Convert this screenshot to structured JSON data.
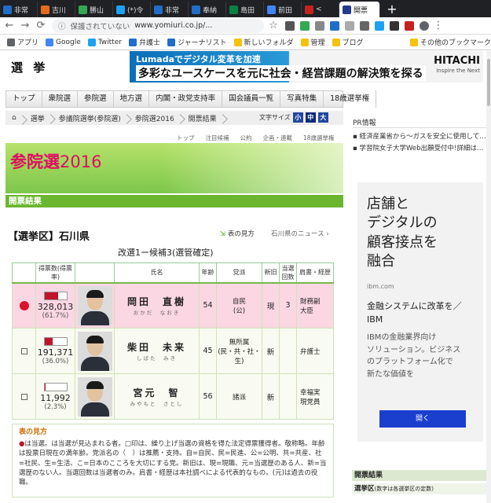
{
  "browser": {
    "tabs": [
      {
        "label": "非常",
        "color": "#1f6ec9",
        "glyph": "文"
      },
      {
        "label": "吉川",
        "color": "#e66a1e",
        "glyph": "吉"
      },
      {
        "label": "勝山",
        "color": "#34a853",
        "glyph": "map"
      },
      {
        "label": "(*)令",
        "color": "#1da1f2",
        "glyph": "bird"
      },
      {
        "label": "非常",
        "color": "#1f6ec9",
        "glyph": "文"
      },
      {
        "label": "奉納",
        "color": "#1f6ec9",
        "glyph": "文"
      },
      {
        "label": "島田",
        "color": "#0b8043",
        "glyph": "g"
      },
      {
        "label": "前田",
        "color": "#4285f4",
        "glyph": "G"
      },
      {
        "label": "<",
        "color": "#c5221f",
        "glyph": "g"
      },
      {
        "label": "開票",
        "color": "#243b8c",
        "glyph": "読"
      }
    ],
    "security_label": "保護されていない",
    "url": "www.yomiuri.co.jp/...",
    "bookmarks": [
      {
        "label": "アプリ",
        "color": "#5f6368"
      },
      {
        "label": "Google",
        "color": "#4285f4"
      },
      {
        "label": "Twitter",
        "color": "#1da1f2"
      },
      {
        "label": "弁護士",
        "color": "#1f6ec9"
      },
      {
        "label": "ジャーナリスト",
        "color": "#1f6ec9"
      },
      {
        "label": "新しいフォルダ",
        "color": "#f4c20d"
      },
      {
        "label": "管理",
        "color": "#f4c20d"
      },
      {
        "label": "ブログ",
        "color": "#f4c20d"
      },
      {
        "label": "その他のブックマーク",
        "color": "#f4c20d"
      }
    ]
  },
  "site": {
    "logo": "選 挙",
    "top_ad": {
      "line1": "Lumadaでデジタル変革を加速",
      "line2": "多彩なユースケースを元に社会・経営課題の解決策を探る",
      "brand": "HITACHI",
      "tagline": "Inspire the Next"
    },
    "gnav": [
      "トップ",
      "衆院選",
      "参院選",
      "地方選",
      "内閣・政党支持率",
      "国会議員一覧",
      "写真特集",
      "18歳選挙権"
    ],
    "breadcrumbs": [
      "選挙",
      "参議院選挙(参院選)",
      "参院選2016",
      "開票結果"
    ],
    "fontsize": {
      "label": "文字サイズ",
      "small": "小",
      "medium": "中",
      "large": "大"
    },
    "subnav": [
      "トップ",
      "注目候補",
      "公約",
      "企画・連載",
      "18歳選挙権"
    ],
    "hero_title": "参院選",
    "hero_year": "2016",
    "section_title": "開票結果",
    "district": "【選挙区】石川県",
    "howto_link": "表の見方",
    "pref_news_link": "石川県のニュース",
    "seats_info": "改選1ー候補3(選管確定)"
  },
  "table": {
    "headers": [
      "",
      "得票数(得票率)",
      "",
      "氏名",
      "年齢",
      "党派",
      "新旧",
      "当選回数",
      "肩書・経歴"
    ],
    "rows": [
      {
        "status": "当選",
        "votes": "328,013",
        "pct": "(61.7%)",
        "share": 0.617,
        "name": "岡田　直樹",
        "kana": "おかだ　なおき",
        "age": "54",
        "party": "自民\n(公)",
        "incumbency": "現",
        "terms": "3",
        "career": "財務副\n大臣",
        "winner": true
      },
      {
        "status": "",
        "votes": "191,371",
        "pct": "(36.0%)",
        "share": 0.36,
        "name": "柴田　未来",
        "kana": "しばた　みき",
        "age": "45",
        "party": "無所属\n(民・共・社・生)",
        "incumbency": "新",
        "terms": "",
        "career": "弁護士",
        "winner": false
      },
      {
        "status": "",
        "votes": "11,992",
        "pct": "(2.3%)",
        "share": 0.023,
        "name": "宮元　智",
        "kana": "みやもと　さとし",
        "age": "56",
        "party": "諸派",
        "incumbency": "新",
        "terms": "",
        "career": "幸福実\n現党員",
        "winner": false
      }
    ]
  },
  "legend": {
    "title": "表の見方",
    "body": "は当選。は当選が見込まれる者。□印は、繰り上げ当選の資格を得た法定得票獲得者。敬称略。年齢は投票日現在の満年齢。党派名の（　）は推薦・支持。自=自民、民=民進、公=公明、共=共産、社=社民、生=生活、こ=日本のこころを大切にする党。新旧は、現=現職、元=当選歴のある人、新=当選歴のない人。当選回数は当選者のみ。肩書・経歴は本社調べによる代表的なもの。(元)は過去の役職。"
  },
  "sidebar": {
    "pr_title": "PR情報",
    "pr_items": [
      "経済産業省から～ガスを安全に使用していただくために～",
      "学習院女子大学Web出願受付中!詳細はこちら"
    ],
    "ad": {
      "headline": "店舗と\nデジタルの\n顧客接点を\n融合",
      "source": "ibm.com",
      "subhead": "金融システムに改革を／\nIBM",
      "body": "IBMの金融業界向け\nソリューション。ビジネス\nのプラットフォーム化で\n新たな価値を",
      "button": "開く"
    },
    "results_title": "開票結果",
    "results_sub": "選挙区",
    "results_note": "(数字は各選挙区の定数)"
  }
}
